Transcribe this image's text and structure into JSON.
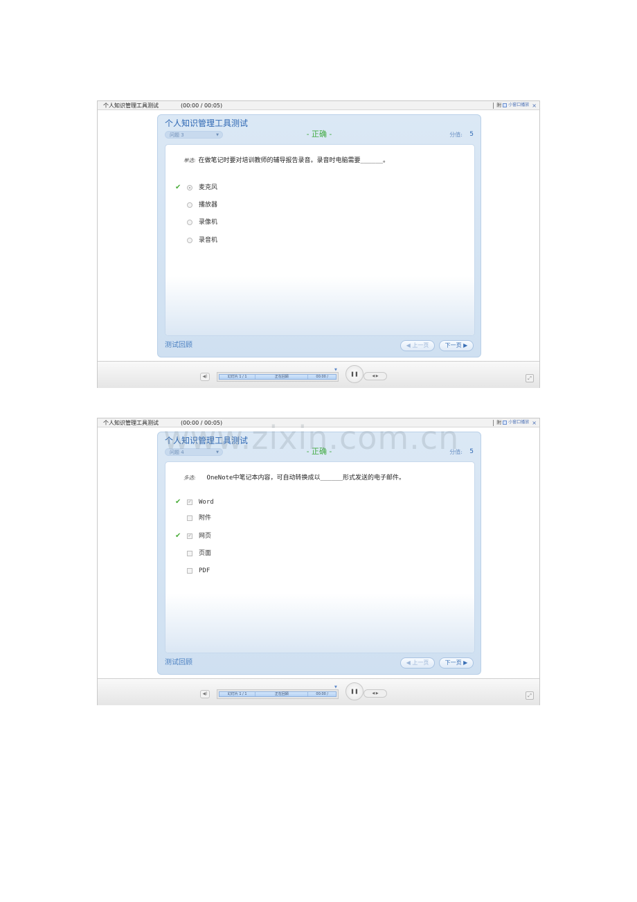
{
  "colors": {
    "accent": "#2d67b3",
    "correct": "#3faa3f",
    "card_bg": "#d6e5f4"
  },
  "watermark": "www.zixin.com.cn",
  "slides": [
    {
      "window_title": "个人知识管理工具测试",
      "time": "(00:00 / 00:05)",
      "attach_label": "附",
      "mini_label": "小窗口播放",
      "close_icon": "×",
      "quiz_title": "个人知识管理工具测试",
      "question_selector": "问题 3",
      "status": "- 正确 -",
      "score_label": "分值:",
      "score_value": "5",
      "question_type": "单选:",
      "question_text": "在做笔记时要对培训教师的辅导报告录音。录音时电脑需要______。",
      "options": [
        {
          "label": "麦克风",
          "correct": true,
          "selected": true
        },
        {
          "label": "播放器",
          "correct": false,
          "selected": false
        },
        {
          "label": "录像机",
          "correct": false,
          "selected": false
        },
        {
          "label": "录音机",
          "correct": false,
          "selected": false
        }
      ],
      "review_label": "测试回顾",
      "prev_label": "◀ 上一页",
      "next_label": "下一页 ▶",
      "progress": {
        "slide": "幻灯片 1 / 1",
        "state": "正在回顾",
        "time": "00:00 /"
      }
    },
    {
      "window_title": "个人知识管理工具测试",
      "time": "(00:00 / 00:05)",
      "attach_label": "附",
      "mini_label": "小窗口播放",
      "close_icon": "×",
      "quiz_title": "个人知识管理工具测试",
      "question_selector": "问题 4",
      "status": "- 正确 -",
      "score_label": "分值:",
      "score_value": "5",
      "question_type": "多选:",
      "question_text": "OneNote中笔记本内容，可自动转换成以______形式发送的电子邮件。",
      "options": [
        {
          "label": "Word",
          "correct": true,
          "selected": true
        },
        {
          "label": "附件",
          "correct": false,
          "selected": false
        },
        {
          "label": "网页",
          "correct": true,
          "selected": true
        },
        {
          "label": "页面",
          "correct": false,
          "selected": false
        },
        {
          "label": "PDF",
          "correct": false,
          "selected": false
        }
      ],
      "review_label": "测试回顾",
      "prev_label": "◀ 上一页",
      "next_label": "下一页 ▶",
      "progress": {
        "slide": "幻灯片 1 / 1",
        "state": "正在回顾",
        "time": "00:00 /"
      }
    }
  ]
}
